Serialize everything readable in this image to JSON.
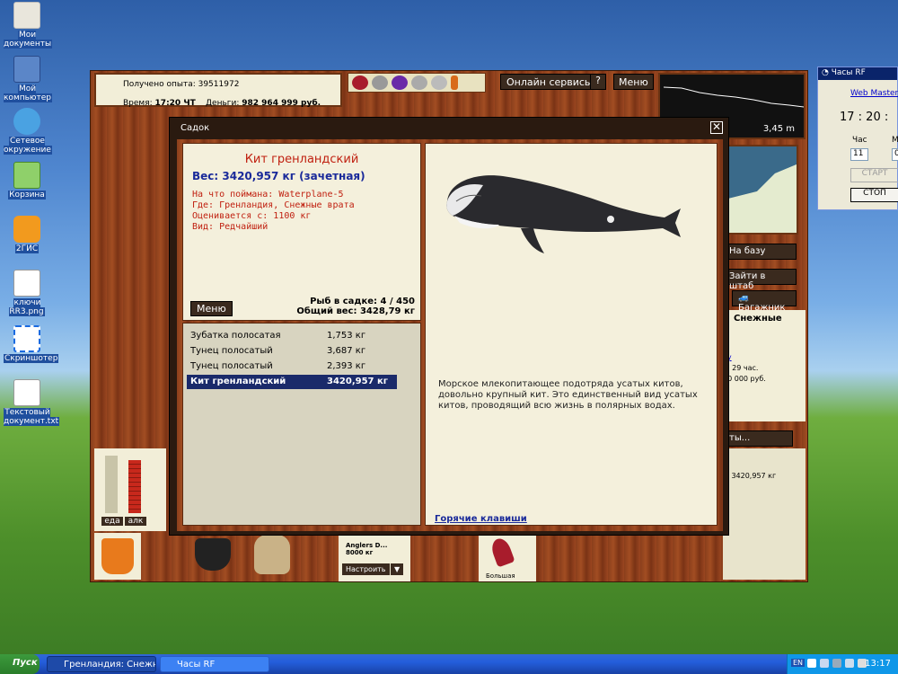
{
  "desktop": {
    "icons": [
      {
        "label": "Мои документы"
      },
      {
        "label": "Мой компьютер"
      },
      {
        "label": "Сетевое окружение"
      },
      {
        "label": "Корзина"
      },
      {
        "label": "2ГИС"
      },
      {
        "label": "ключи RR3.png"
      },
      {
        "label": "Скриншотер"
      },
      {
        "label": "Текстовый документ.txt"
      }
    ]
  },
  "game": {
    "experience": "Получено опыта: 39511972",
    "time_label": "Время:",
    "time_value": "17:20 ЧТ",
    "money_label": "Деньги:",
    "money_value": "982 964 999 руб.",
    "online_services": "Онлайн сервисы",
    "help": "?",
    "menu": "Меню",
    "depth": "3,45 m",
    "to_base": "На базу",
    "to_hq": "Зайти в штаб",
    "trunk": "Багажник",
    "location_snippet": "Снежные",
    "info_lines": [
      "ку",
      "а: 29 час.",
      "00 000 руб.",
      "3"
    ],
    "more_button": "ты...",
    "catch_snippet": "а 3420,957 кг",
    "food_label": "еда",
    "alc_label": "алк",
    "food_level": 0.0,
    "alc_level": 0.95,
    "tackle_name": "Anglers D...",
    "tackle_weight": "8000 кг",
    "tackle_setup": "Настроить",
    "tackle_arrow": "▼",
    "lure_label": "Большая"
  },
  "dialog": {
    "title": "Садок",
    "close": "✕",
    "fish_name": "Кит гренландский",
    "weight_line": "Вес: 3420,957 кг (зачетная)",
    "details": [
      "На что поймана: Waterplane-5",
      "Где: Гренландия, Снежные врата",
      "Оценивается с: 1100 кг",
      "Вид: Редчайший"
    ],
    "menu_button": "Меню",
    "fish_count": "Рыб в садке: 4 / 450",
    "total_weight": "Общий вес: 3428,79 кг",
    "catch_list": [
      {
        "name": "Зубатка полосатая",
        "weight": "1,753 кг"
      },
      {
        "name": "Тунец полосатый",
        "weight": "3,687 кг"
      },
      {
        "name": "Тунец полосатый",
        "weight": "2,393 кг"
      },
      {
        "name": "Кит гренландский",
        "weight": "3420,957 кг"
      }
    ],
    "description": "Морское млекопитающее подотряда усатых китов, довольно крупный кит. Это единственный вид усатых китов, проводящий всю жизнь в полярных водах.",
    "hotkeys": "Горячие клавиши"
  },
  "clock_window": {
    "title": "Часы RF",
    "web_master": "Web Master (I",
    "time": "17 :   20 :",
    "hour_label": "Час",
    "min_label": "М",
    "hour_value": "11",
    "min_value": "0",
    "start": "СТАРТ",
    "stop": "СТОП"
  },
  "taskbar": {
    "start": "Пуск",
    "tasks": [
      {
        "label": "Гренландия: Снежн..."
      },
      {
        "label": "Часы RF"
      }
    ],
    "lang": "EN",
    "clock": "13:17"
  }
}
